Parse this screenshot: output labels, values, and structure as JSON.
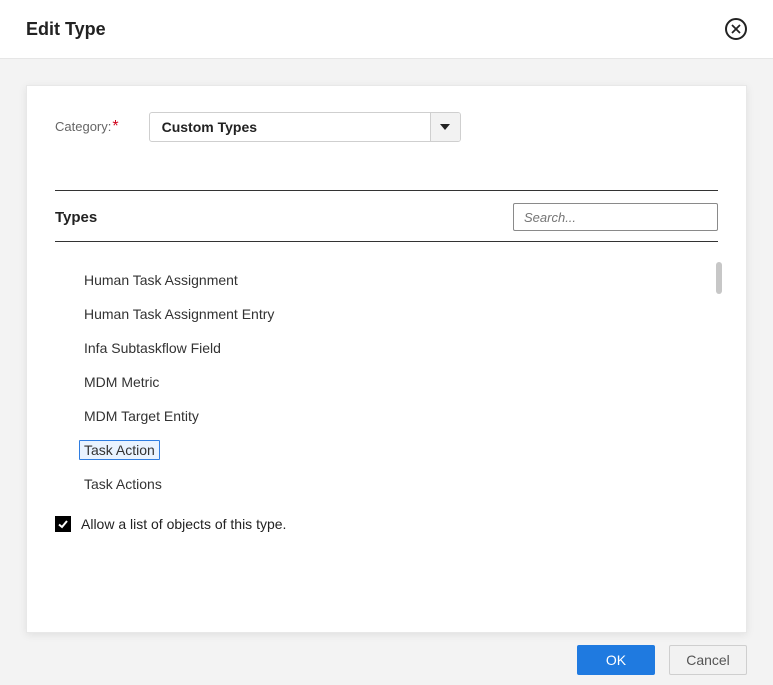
{
  "dialog": {
    "title": "Edit Type"
  },
  "category": {
    "label": "Category:",
    "required_mark": "*",
    "selected": "Custom Types"
  },
  "types": {
    "heading": "Types",
    "search_placeholder": "Search...",
    "items": [
      {
        "label": "Human Task Assignment",
        "selected": false
      },
      {
        "label": "Human Task Assignment Entry",
        "selected": false
      },
      {
        "label": "Infa Subtaskflow Field",
        "selected": false
      },
      {
        "label": "MDM Metric",
        "selected": false
      },
      {
        "label": "MDM Target Entity",
        "selected": false
      },
      {
        "label": "Task Action",
        "selected": true
      },
      {
        "label": "Task Actions",
        "selected": false
      }
    ]
  },
  "allow_list": {
    "checked": true,
    "label": "Allow a list of objects of this type."
  },
  "buttons": {
    "ok": "OK",
    "cancel": "Cancel"
  }
}
